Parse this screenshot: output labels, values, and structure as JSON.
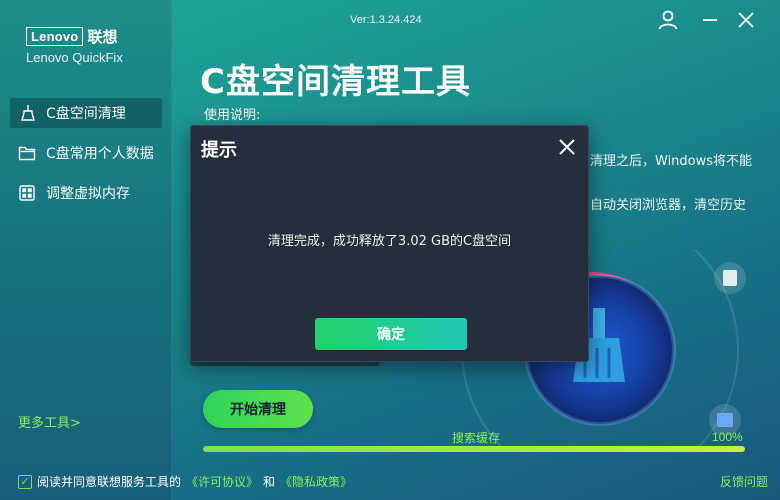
{
  "app": {
    "brand_en": "Lenovo",
    "brand_cn": "联想",
    "product": "Lenovo QuickFix",
    "version": "Ver:1.3.24.424"
  },
  "sidebar": {
    "items": [
      {
        "label": "C盘空间清理",
        "icon": "broom-icon",
        "active": true
      },
      {
        "label": "C盘常用个人数据",
        "icon": "folder-icon",
        "active": false
      },
      {
        "label": "调整虚拟内存",
        "icon": "memory-icon",
        "active": false
      }
    ],
    "more_tools": "更多工具>"
  },
  "main": {
    "title": "C盘空间清理工具",
    "usage_label": "使用说明:",
    "usage_line1_fragment": "清理之后，Windows将不能",
    "usage_line2_fragment": "自动关闭浏览器，清空历史",
    "start_button": "开始清理",
    "progress_label": "搜索缓存",
    "progress_value": "100%",
    "progress_fraction": 1.0
  },
  "footer": {
    "agree_prefix": "阅读并同意联想服务工具的",
    "license_link": "《许可协议》",
    "and": "和",
    "privacy_link": "《隐私政策》",
    "feedback": "反馈问题"
  },
  "dialog": {
    "title": "提示",
    "message": "清理完成，成功释放了3.02 GB的C盘空间",
    "confirm": "确定"
  },
  "colors": {
    "accent_green": "#8cf15a",
    "dialog_bg": "#242e3c",
    "button_gradient_start": "#23d266",
    "button_gradient_end": "#22c7b8"
  }
}
